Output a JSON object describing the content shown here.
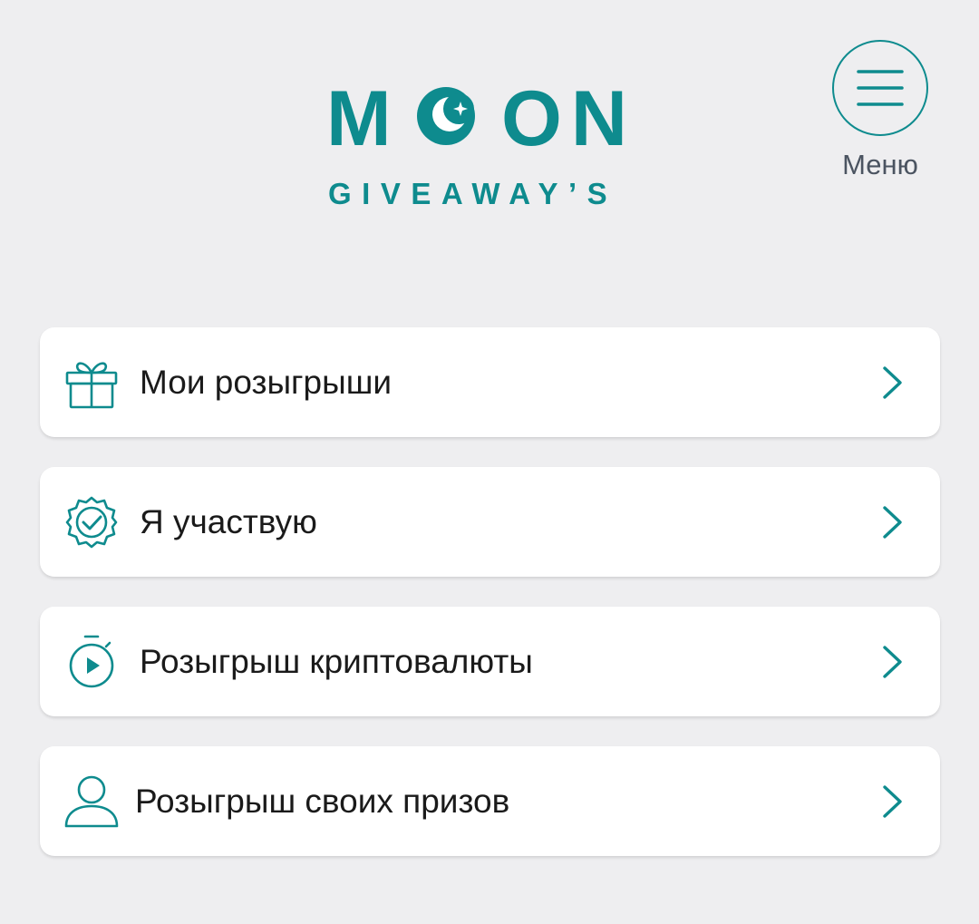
{
  "header": {
    "logo_word": "MOON",
    "logo_word_left": "M",
    "logo_word_right": "ON",
    "logo_sub": "GIVEAWAY’S",
    "menu_label": "Меню"
  },
  "items": [
    {
      "label": "Мои розыгрыши",
      "icon": "gift-icon"
    },
    {
      "label": "Я участвую",
      "icon": "verified-badge-icon"
    },
    {
      "label": "Розыгрыш криптовалюты",
      "icon": "stopwatch-play-icon"
    },
    {
      "label": "Розыгрыш своих призов",
      "icon": "user-icon"
    }
  ],
  "colors": {
    "accent": "#0E8B8E",
    "background": "#EEEEF0",
    "card": "#FFFFFF",
    "text": "#1A1A1A",
    "menu_text": "#4B5461"
  }
}
